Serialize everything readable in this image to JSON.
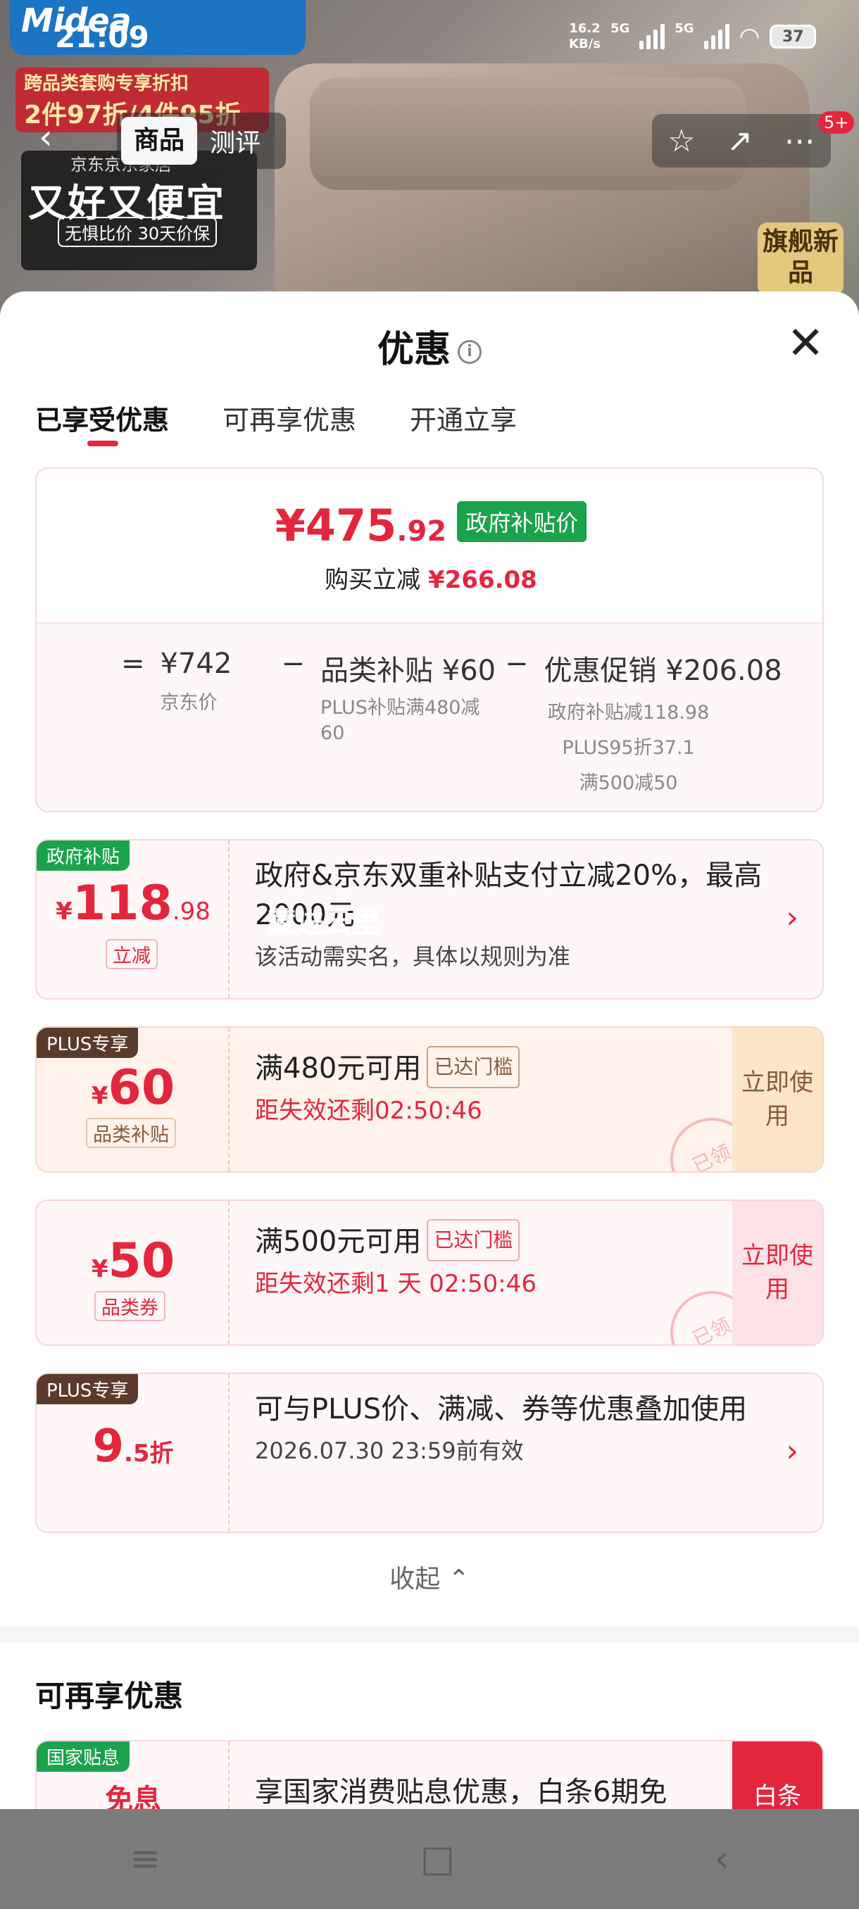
{
  "status": {
    "time": "21:09",
    "net_speed_value": "16.2",
    "net_speed_unit": "KB/s",
    "sim1": "5G",
    "sim2": "5G",
    "battery": "37"
  },
  "product": {
    "brand": "Midea",
    "promo_line1": "跨品类套购专享折扣",
    "promo_line2": "2件97折/4件95折",
    "promo_black_top": "京东京东家居",
    "promo_black_main": "又好又便宜",
    "promo_black_sub": "无惧比价 30天价保",
    "flagship_badge": "旗舰新品"
  },
  "nav": {
    "tabs": [
      "商品",
      "测评"
    ],
    "badge": "5+"
  },
  "sheet": {
    "title": "优惠",
    "tabs": [
      "已享受优惠",
      "可再享优惠",
      "开通立享"
    ],
    "summary": {
      "price_symbol": "¥",
      "price_int": "475",
      "price_dec": ".92",
      "price_tag": "政府补贴价",
      "reduce_label": "购买立减",
      "reduce_value": "¥266.08",
      "jd_price": "¥742",
      "jd_price_label": "京东价",
      "category_subsidy": "品类补贴 ¥60",
      "category_subsidy_desc": "PLUS补贴满480减60",
      "promotion": "优惠促销 ¥206.08",
      "promotion_desc1": "政府补贴减118.98",
      "promotion_desc2": "PLUS95折37.1",
      "promotion_desc3": "满500减50"
    },
    "coupons": [
      {
        "tag": "政府补贴",
        "amount_int": "118",
        "amount_dec": ".98",
        "small": "立减",
        "title": "政府&京东双重补贴支付立减20%，最高2000元",
        "desc": "该活动需实名，具体以规则为准"
      },
      {
        "tag": "PLUS专享",
        "amount_int": "60",
        "small": "品类补贴",
        "title": "满480元可用",
        "meet": "已达门槛",
        "countdown": "距失效还剩02:50:46",
        "action": "立即使用",
        "stamp": "已领"
      },
      {
        "amount_int": "50",
        "small": "品类券",
        "title": "满500元可用",
        "meet": "已达门槛",
        "countdown": "距失效还剩1 天 02:50:46",
        "action": "立即使用",
        "stamp": "已领"
      },
      {
        "tag": "PLUS专享",
        "discount_int": "9",
        "discount_dec": ".5折",
        "title": "可与PLUS价、满减、券等优惠叠加使用",
        "desc": "2026.07.30 23:59前有效"
      }
    ],
    "collapse": "收起 ⌃",
    "more_title": "可再享优惠",
    "more_coupon": {
      "tag": "国家贴息",
      "amount": "免息",
      "title": "享国家消费贴息优惠，白条6期免",
      "action": "白条"
    },
    "watermark": "藏进云里"
  }
}
